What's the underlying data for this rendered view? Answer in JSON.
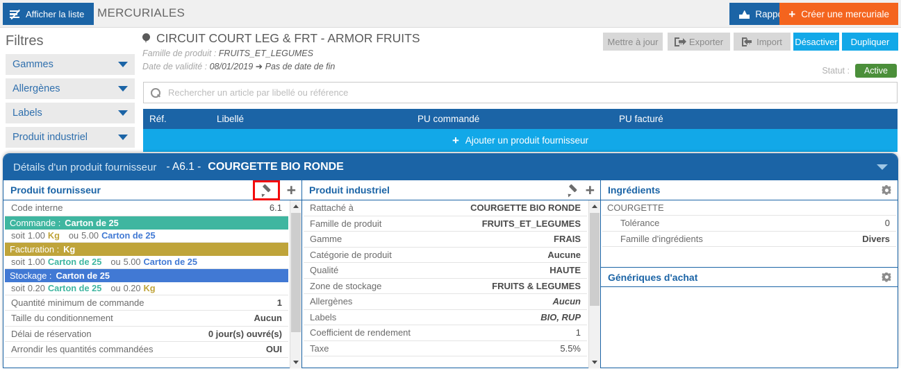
{
  "topbar": {
    "list_button": "Afficher la liste",
    "app_title": "MERCURIALES",
    "reports_button": "Rapports",
    "create_button": "Créer une mercuriale"
  },
  "sidebar": {
    "title": "Filtres",
    "items": [
      {
        "label": "Gammes"
      },
      {
        "label": "Allergènes"
      },
      {
        "label": "Labels"
      },
      {
        "label": "Produit industriel"
      }
    ]
  },
  "header": {
    "mercuriale_name": "CIRCUIT COURT LEG & FRT - ARMOR FRUITS",
    "family_label": "Famille de produit :",
    "family_value": "FRUITS_ET_LEGUMES",
    "validity_label": "Date de validité :",
    "validity_start": "08/01/2019",
    "validity_end": "Pas de date de fin",
    "status_label": "Statut :",
    "status_value": "Active",
    "actions": {
      "update": "Mettre à jour",
      "export": "Exporter",
      "import": "Import",
      "deactivate": "Désactiver",
      "duplicate": "Dupliquer"
    }
  },
  "search": {
    "placeholder": "Rechercher un article par libellé ou référence",
    "value": ""
  },
  "table": {
    "columns": [
      "Réf.",
      "Libellé",
      "PU commandé",
      "PU facturé"
    ],
    "add_row_label": "Ajouter un produit fournisseur"
  },
  "detail_panel": {
    "title": "Détails d'un produit fournisseur",
    "code": "- A6.1 -",
    "product_name": "COURGETTE BIO RONDE",
    "supplier": {
      "heading": "Produit fournisseur",
      "rows": [
        {
          "key": "Code interne",
          "value": "6.1"
        },
        {
          "key": "Quantité minimum de commande",
          "value": "1"
        },
        {
          "key": "Taille du conditionnement",
          "value": "Aucun"
        },
        {
          "key": "Délai de réservation",
          "value": "0 jour(s) ouvré(s)"
        },
        {
          "key": "Arrondir les quantités commandées",
          "value": "OUI"
        }
      ],
      "units": [
        {
          "band_label": "Commande :",
          "band_value": "Carton de 25",
          "band_color": "#3fb6a0",
          "conv_prefix": "soit",
          "q1": "1.00",
          "u1": "Kg",
          "u1_color": "khaki",
          "sep": "ou",
          "q2": "5.00",
          "u2": "Carton de 25",
          "u2_color": "blue"
        },
        {
          "band_label": "Facturation :",
          "band_value": "Kg",
          "band_color": "#bfa43a",
          "conv_prefix": "soit",
          "q1": "1.00",
          "u1": "Carton de 25",
          "u1_color": "teal",
          "sep": "ou",
          "q2": "5.00",
          "u2": "Carton de 25",
          "u2_color": "blue"
        },
        {
          "band_label": "Stockage :",
          "band_value": "Carton de 25",
          "band_color": "#4179d4",
          "conv_prefix": "soit",
          "q1": "0.20",
          "u1": "Carton de 25",
          "u1_color": "teal",
          "sep": "ou",
          "q2": "0.20",
          "u2": "Kg",
          "u2_color": "khaki"
        }
      ]
    },
    "industrial": {
      "heading": "Produit industriel",
      "rows": [
        {
          "key": "Rattaché à",
          "value": "COURGETTE BIO RONDE"
        },
        {
          "key": "Famille de produit",
          "value": "FRUITS_ET_LEGUMES"
        },
        {
          "key": "Gamme",
          "value": "FRAIS"
        },
        {
          "key": "Catégorie de produit",
          "value": "Aucune"
        },
        {
          "key": "Qualité",
          "value": "HAUTE"
        },
        {
          "key": "Zone de stockage",
          "value": "FRUITS & LEGUMES"
        },
        {
          "key": "Allergènes",
          "value": "Aucun"
        },
        {
          "key": "Labels",
          "value": "BIO, RUP"
        },
        {
          "key": "Coefficient de rendement",
          "value": "1"
        },
        {
          "key": "Taxe",
          "value": "5.5%"
        }
      ]
    },
    "ingredients": {
      "heading": "Ingrédients",
      "name": "COURGETTE",
      "rows": [
        {
          "key": "Tolérance",
          "value": "0"
        },
        {
          "key": "Famille d'ingrédients",
          "value": "Divers"
        }
      ]
    },
    "generics": {
      "heading": "Génériques d'achat"
    }
  },
  "colors": {
    "primary_blue": "#1b64a6",
    "cyan": "#12a8e8",
    "orange": "#f4641e",
    "green_badge": "#4b8f3a",
    "teal": "#3fb6a0",
    "khaki": "#bfa43a",
    "unit_blue": "#4179d4",
    "highlight_red": "#f30b0b"
  },
  "icons": {
    "list": "list-icon",
    "report": "report-icon",
    "plus": "plus-icon",
    "search": "search-icon",
    "pin": "location-pin-icon",
    "export": "export-icon",
    "import": "import-icon",
    "pencil": "pencil-icon",
    "gear": "gear-icon",
    "caret_down": "chevron-down-icon",
    "arrow_right": "arrow-right-icon"
  }
}
